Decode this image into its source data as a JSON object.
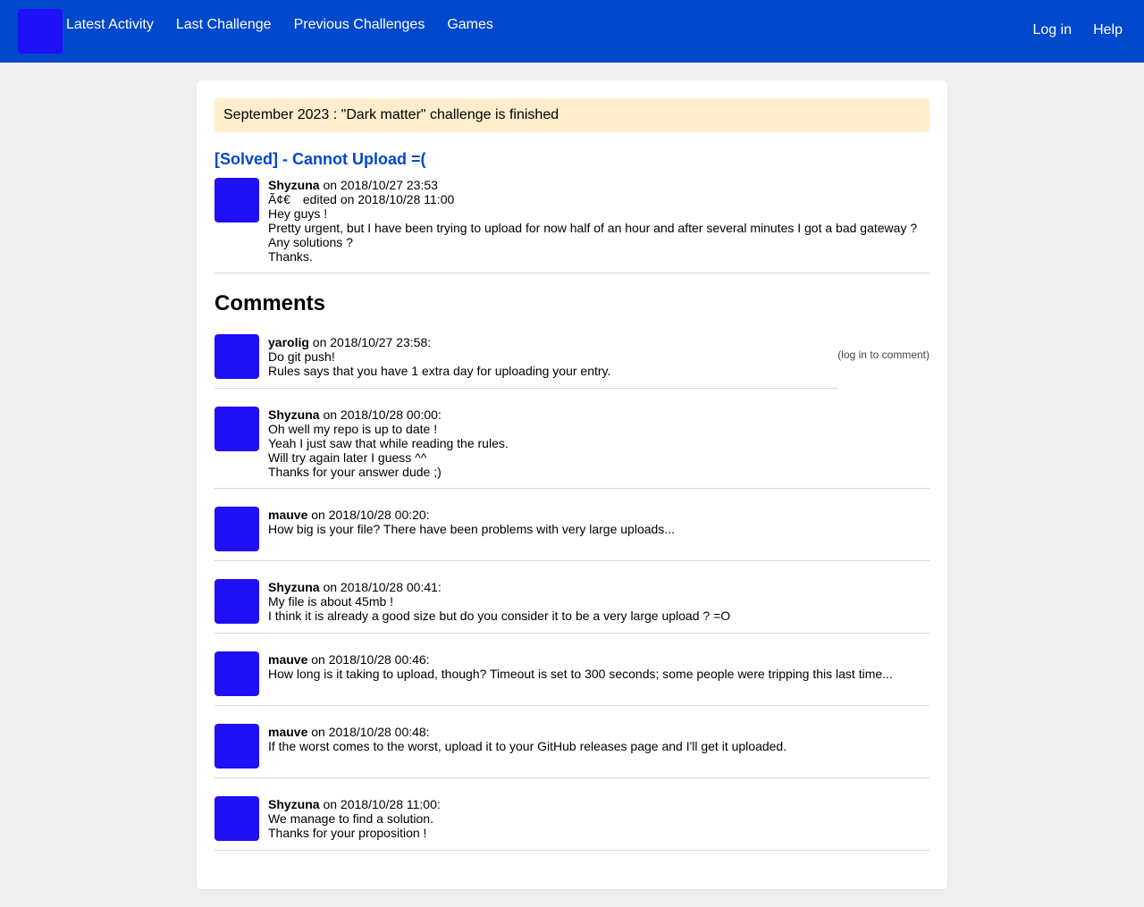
{
  "header": {
    "nav": [
      "Latest Activity",
      "Last Challenge",
      "Previous Challenges",
      "Games"
    ],
    "right": [
      "Log in",
      "Help"
    ]
  },
  "banner": "September 2023 : \"Dark matter\" challenge is finished",
  "post": {
    "title": "[Solved] - Cannot Upload =(",
    "author": "Shyzuna",
    "date": " on 2018/10/27 23:53",
    "edit_prefix": "Ã¢€",
    "edited": "edited on 2018/10/28 11:00",
    "lines": [
      "Hey guys !",
      "Pretty urgent, but I have been trying to upload for now half of an hour and after several minutes I got a bad gateway ?",
      "Any solutions ?",
      "Thanks."
    ]
  },
  "comments_heading": "Comments",
  "login_hint": "(log in to comment)",
  "comments": [
    {
      "author": "yarolig",
      "date": " on 2018/10/27 23:58:",
      "lines": [
        "Do git push!",
        "Rules says that you have 1 extra day for uploading your entry."
      ]
    },
    {
      "author": "Shyzuna",
      "date": " on 2018/10/28 00:00:",
      "lines": [
        "Oh well my repo is up to date !",
        "Yeah I just saw that while reading the rules.",
        "Will try again later I guess ^^",
        "Thanks for your answer dude ;)"
      ]
    },
    {
      "author": "mauve",
      "date": " on 2018/10/28 00:20:",
      "lines": [
        "How big is your file? There have been problems with very large uploads..."
      ]
    },
    {
      "author": "Shyzuna",
      "date": " on 2018/10/28 00:41:",
      "lines": [
        "My file is about 45mb !",
        "I think it is already a good size but do you consider it to be a very large upload ? =O"
      ]
    },
    {
      "author": "mauve",
      "date": " on 2018/10/28 00:46:",
      "lines": [
        "How long is it taking to upload, though? Timeout is set to 300 seconds; some people were tripping this last time..."
      ]
    },
    {
      "author": "mauve",
      "date": " on 2018/10/28 00:48:",
      "lines": [
        "If the worst comes to the worst, upload it to your GitHub releases page and I'll get it uploaded."
      ]
    },
    {
      "author": "Shyzuna",
      "date": " on 2018/10/28 11:00:",
      "lines": [
        "We manage to find a solution.",
        "Thanks for your proposition !"
      ]
    }
  ],
  "colors": {
    "header_bg": "#0048cc",
    "avatar": "#1f10f5",
    "banner_bg": "#ffeecc",
    "title": "#0048cc"
  }
}
